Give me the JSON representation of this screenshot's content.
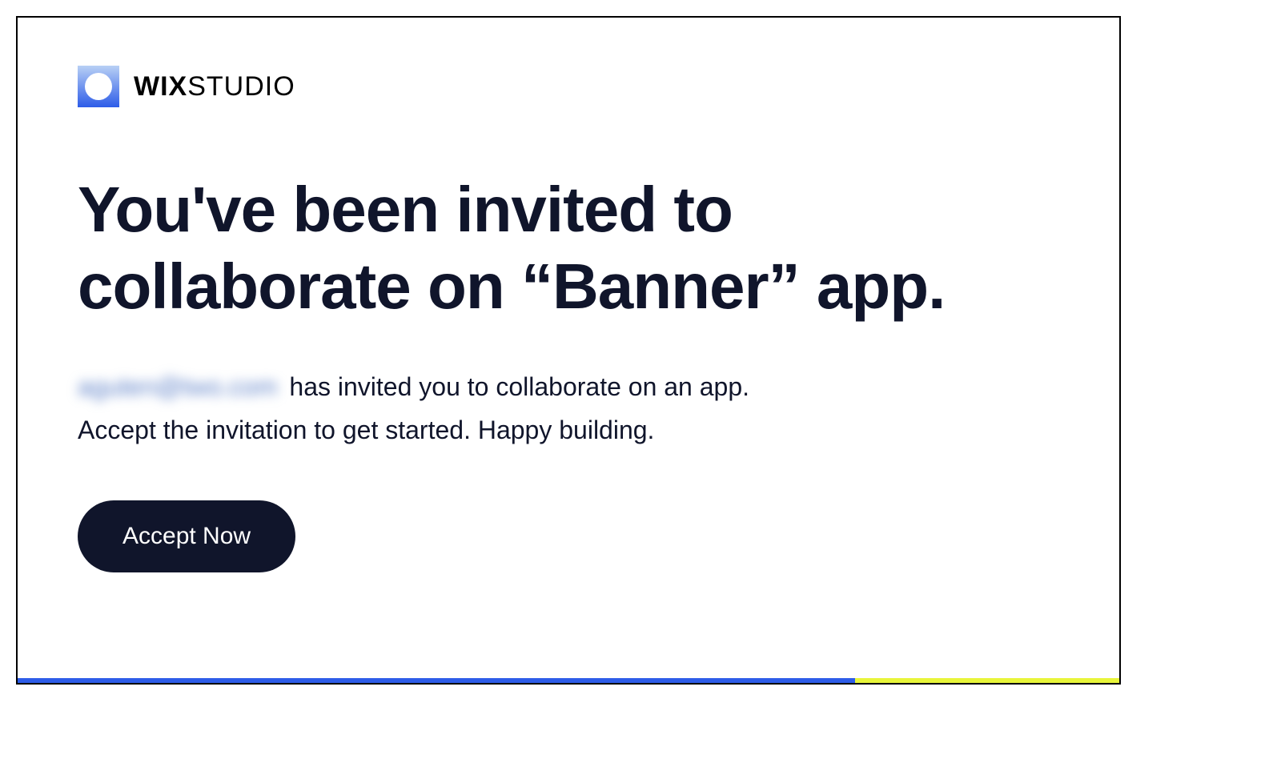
{
  "logo": {
    "brand_bold": "WIX",
    "brand_light": "STUDIO"
  },
  "headline": "You've been invited to collaborate on “Banner” app.",
  "body": {
    "inviter_email_blurred": "aguten@two.com",
    "line1_suffix": " has invited you to collaborate on an app.",
    "line2": "Accept the invitation to get started. Happy building."
  },
  "cta": {
    "label": "Accept Now"
  }
}
